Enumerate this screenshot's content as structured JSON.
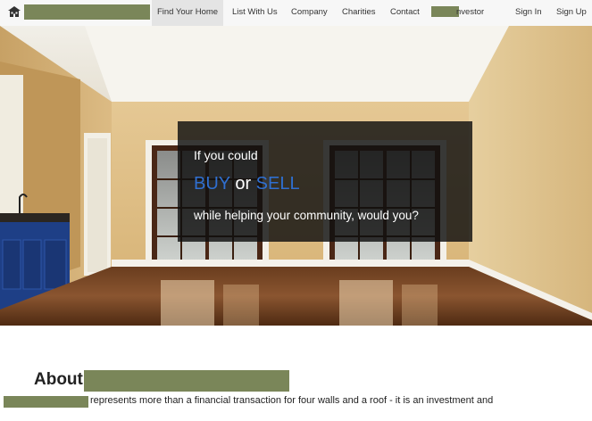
{
  "nav": {
    "brand_text": "",
    "items": [
      {
        "label": "Find Your Home",
        "active": true
      },
      {
        "label": "List With Us",
        "active": false
      },
      {
        "label": "Company",
        "active": false
      },
      {
        "label": "Charities",
        "active": false
      },
      {
        "label": "Contact",
        "active": false
      },
      {
        "label": "nvestor",
        "active": false
      }
    ],
    "sign_in": "Sign In",
    "sign_up": "Sign Up"
  },
  "hero": {
    "line1": "If you could",
    "buy": "BUY",
    "or": " or ",
    "sell": "SELL",
    "line3": "while helping your community, would you?"
  },
  "about": {
    "title": "About",
    "text": "represents more than a financial transaction for four walls and a roof - it is an investment and"
  },
  "colors": {
    "nav_bg": "#f7f7f7",
    "accent_blue": "#2f6fd0",
    "redaction": "#7a8659",
    "overlay": "#0f0f0f"
  }
}
